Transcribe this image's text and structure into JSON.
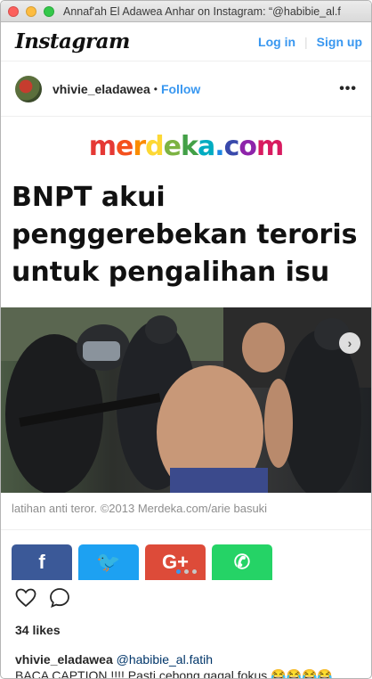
{
  "window": {
    "title": "Annaf'ah El Adawea Anhar on Instagram: “@habibie_al.f"
  },
  "header": {
    "logo": "Instagram",
    "login": "Log in",
    "signup": "Sign up"
  },
  "post": {
    "username": "vhivie_eladawea",
    "dot": "•",
    "follow": "Follow",
    "more": "•••",
    "media": {
      "brand": "merdeka.com",
      "brand_colors": [
        "#e53935",
        "#f4511e",
        "#fb8c00",
        "#fdd835",
        "#7cb342",
        "#43a047",
        "#00acc1",
        "#1e88e5",
        "#3949ab",
        "#8e24aa",
        "#d81b60"
      ],
      "headline_lines": [
        "BNPT akui",
        "penggerebekan teroris",
        "untuk pengalihan isu"
      ],
      "credit": "latihan anti teror. ©2013 Merdeka.com/arie basuki",
      "share_buttons": [
        {
          "icon": "facebook-icon",
          "glyph": "f",
          "color": "#3b5998"
        },
        {
          "icon": "twitter-icon",
          "glyph": "🐦",
          "color": "#1da1f2"
        },
        {
          "icon": "google-plus-icon",
          "glyph": "G+",
          "color": "#dd4b39"
        },
        {
          "icon": "whatsapp-icon",
          "glyph": "✆",
          "color": "#25d366"
        }
      ],
      "carousel_next": "›"
    },
    "carousel": {
      "current": 1,
      "total": 3
    },
    "likes": "34 likes",
    "caption": {
      "user": "vhivie_eladawea",
      "mention": "@habibie_al.fatih",
      "text": "BACA CAPTION !!!! Pasti cebong gagal fokus 😂😂😂😂"
    }
  }
}
